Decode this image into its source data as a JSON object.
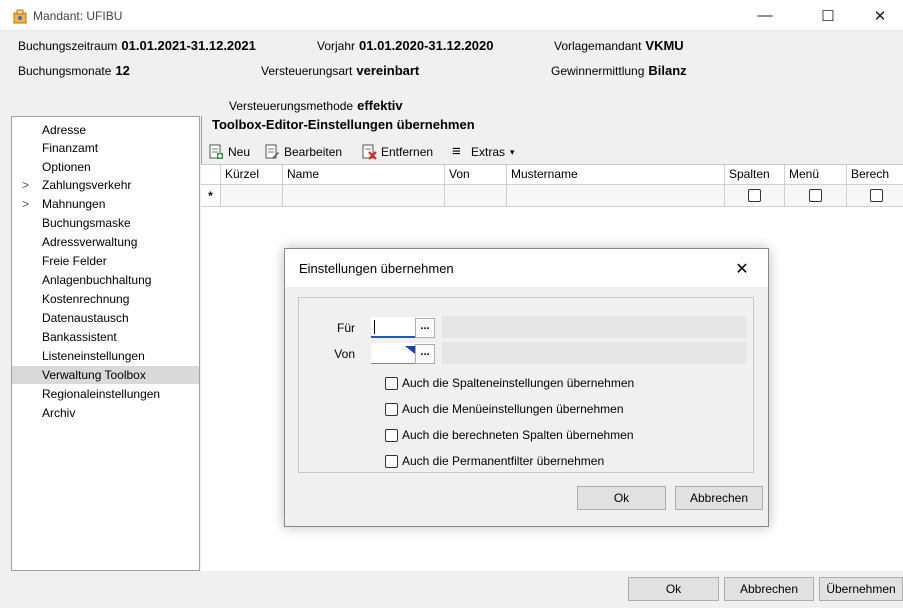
{
  "window": {
    "title": "Mandant: UFIBU",
    "minimize": "—",
    "maximize": "☐",
    "close": "✕"
  },
  "header": {
    "buchungszeitraum_label": "Buchungszeitraum",
    "buchungszeitraum_value": "01.01.2021-31.12.2021",
    "vorjahr_label": "Vorjahr",
    "vorjahr_value": "01.01.2020-31.12.2020",
    "vorlagemandant_label": "Vorlagemandant",
    "vorlagemandant_value": "VKMU",
    "buchungsmonate_label": "Buchungsmonate",
    "buchungsmonate_value": "12",
    "versteuerungsart_label": "Versteuerungsart",
    "versteuerungsart_value": "vereinbart",
    "gewinnermittlung_label": "Gewinnermittlung",
    "gewinnermittlung_value": "Bilanz",
    "versteuerungsmethode_label": "Versteuerungsmethode",
    "versteuerungsmethode_value": "effektiv"
  },
  "nav": {
    "items": [
      {
        "label": "Adresse",
        "expandable": false,
        "selected": false
      },
      {
        "label": "Finanzamt",
        "expandable": false,
        "selected": false
      },
      {
        "label": "Optionen",
        "expandable": false,
        "selected": false
      },
      {
        "label": "Zahlungsverkehr",
        "expandable": true,
        "selected": false
      },
      {
        "label": "Mahnungen",
        "expandable": true,
        "selected": false
      },
      {
        "label": "Buchungsmaske",
        "expandable": false,
        "selected": false
      },
      {
        "label": "Adressverwaltung",
        "expandable": false,
        "selected": false
      },
      {
        "label": "Freie Felder",
        "expandable": false,
        "selected": false
      },
      {
        "label": "Anlagenbuchhaltung",
        "expandable": false,
        "selected": false
      },
      {
        "label": "Kostenrechnung",
        "expandable": false,
        "selected": false
      },
      {
        "label": "Datenaustausch",
        "expandable": false,
        "selected": false
      },
      {
        "label": "Bankassistent",
        "expandable": false,
        "selected": false
      },
      {
        "label": "Listeneinstellungen",
        "expandable": false,
        "selected": false
      },
      {
        "label": "Verwaltung Toolbox",
        "expandable": false,
        "selected": true
      },
      {
        "label": "Regionaleinstellungen",
        "expandable": false,
        "selected": false
      },
      {
        "label": "Archiv",
        "expandable": false,
        "selected": false
      }
    ]
  },
  "section": {
    "title": "Toolbox-Editor-Einstellungen übernehmen"
  },
  "toolbar": {
    "neu": "Neu",
    "bearbeiten": "Bearbeiten",
    "entfernen": "Entfernen",
    "extras": "Extras",
    "extras_arrow": "▾"
  },
  "grid": {
    "columns": [
      "Kürzel",
      "Name",
      "Von",
      "Mustername",
      "Spalten",
      "Menü",
      "Berech"
    ],
    "new_row_marker": "*"
  },
  "buttons": {
    "ok": "Ok",
    "abbrechen": "Abbrechen",
    "uebernehmen": "Übernehmen"
  },
  "dialog": {
    "title": "Einstellungen übernehmen",
    "close": "✕",
    "fuer_label": "Für",
    "von_label": "Von",
    "lookup_button": "...",
    "options": [
      "Auch die Spalteneinstellungen übernehmen",
      "Auch die Menüeinstellungen übernehmen",
      "Auch die berechneten Spalten übernehmen",
      "Auch die Permanentfilter übernehmen"
    ],
    "ok": "Ok",
    "abbrechen": "Abbrechen"
  }
}
